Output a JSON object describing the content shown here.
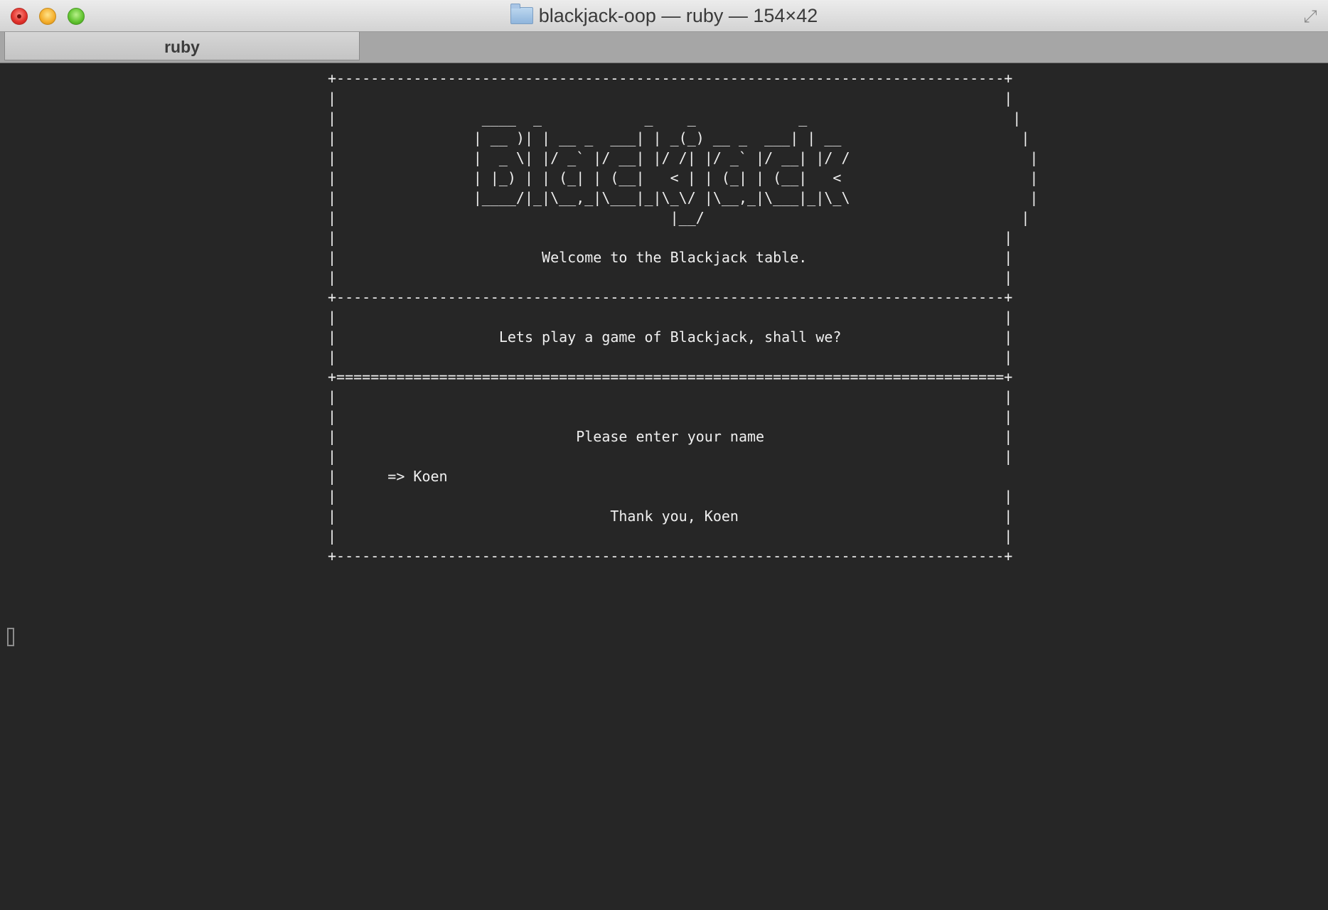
{
  "window": {
    "title": "blackjack-oop — ruby — 154×42",
    "tab_label": "ruby"
  },
  "terminal": {
    "lines": [
      "+------------------------------------------------------------------------------+",
      "|                                                                              |",
      "|                 ____  _            _    _            _                        |",
      "|                | __ )| | __ _  ___| | _(_) __ _  ___| | __                     |",
      "|                |  _ \\| |/ _` |/ __| |/ /| |/ _` |/ __| |/ /                     |",
      "|                | |_) | | (_| | (__|   < | | (_| | (__|   <                      |",
      "|                |____/|_|\\__,_|\\___|_|\\_\\/ |\\__,_|\\___|_|\\_\\                     |",
      "|                                       |__/                                     |",
      "|                                                                              |",
      "|                        Welcome to the Blackjack table.                       |",
      "|                                                                              |",
      "+------------------------------------------------------------------------------+",
      "|                                                                              |",
      "|                   Lets play a game of Blackjack, shall we?                   |",
      "|                                                                              |",
      "+==============================================================================+",
      "|                                                                              |",
      "|                                                                              |",
      "|                            Please enter your name                            |",
      "|                                                                              |",
      "|      => Koen",
      "|                                                                              |",
      "|                                Thank you, Koen                               |",
      "|                                                                              |",
      "+------------------------------------------------------------------------------+"
    ]
  }
}
